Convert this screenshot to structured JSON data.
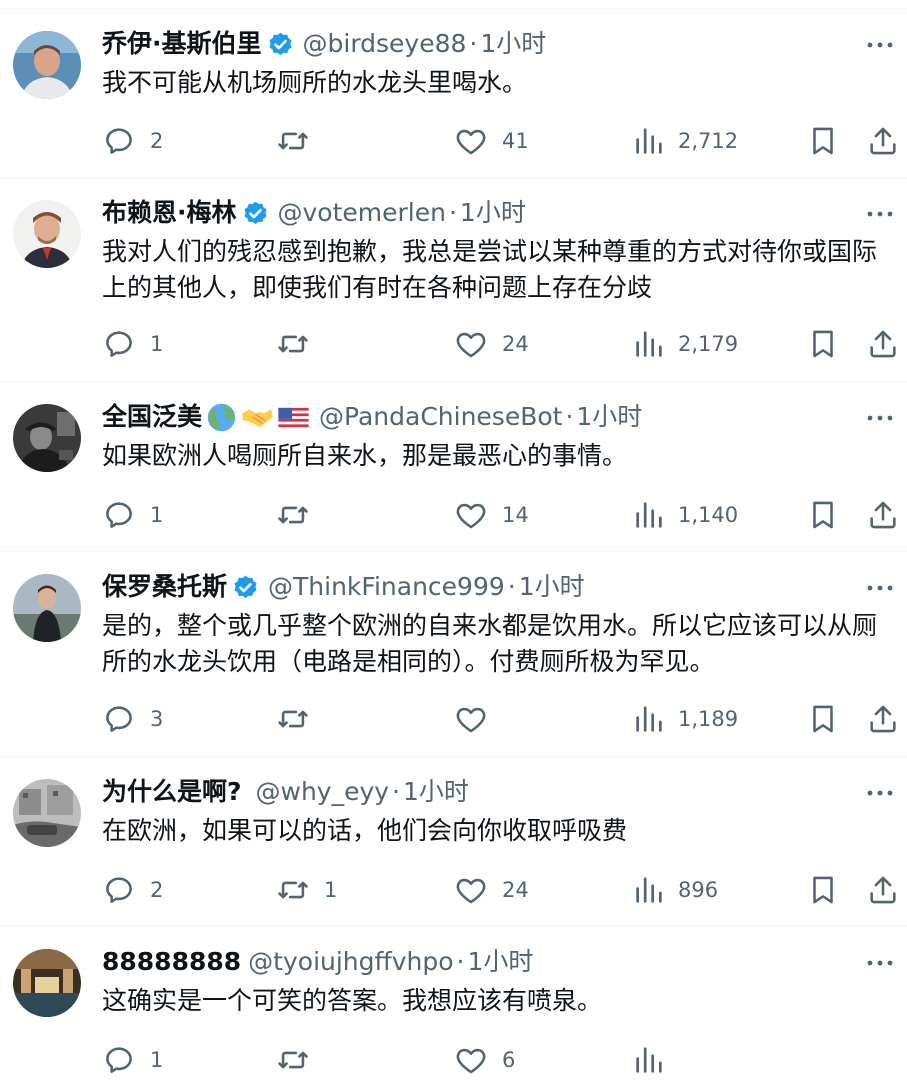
{
  "replies": [
    {
      "name": "乔伊·基斯伯里",
      "verified": true,
      "handle": "@birdseye88",
      "time": "1小时",
      "text": "我不可能从机场厕所的水龙头里喝水。",
      "reply_count": "2",
      "retweet_count": "",
      "like_count": "41",
      "view_count": "2,712"
    },
    {
      "name": "布赖恩·梅林",
      "verified": true,
      "handle": "@votemerlen",
      "time": "1小时",
      "text": "我对人们的残忍感到抱歉，我总是尝试以某种尊重的方式对待你或国际上的其他人，即使我们有时在各种问题上存在分歧",
      "reply_count": "1",
      "retweet_count": "",
      "like_count": "24",
      "view_count": "2,179"
    },
    {
      "name": "全国泛美",
      "verified": false,
      "name_emojis": [
        "globe-emoji",
        "handshake-emoji",
        "us-flag-emoji"
      ],
      "handle": "@PandaChineseBot",
      "time": "1小时",
      "text": "如果欧洲人喝厕所自来水，那是最恶心的事情。",
      "reply_count": "1",
      "retweet_count": "",
      "like_count": "14",
      "view_count": "1,140"
    },
    {
      "name": "保罗桑托斯",
      "verified": true,
      "handle": "@ThinkFinance999",
      "time": "1小时",
      "text": "是的，整个或几乎整个欧洲的自来水都是饮用水。所以它应该可以从厕所的水龙头饮用（电路是相同的）。付费厕所极为罕见。",
      "reply_count": "3",
      "retweet_count": "",
      "like_count": "",
      "view_count": "1,189"
    },
    {
      "name": "为什么是啊?",
      "verified": false,
      "handle": "@why_eyy",
      "time": "1小时",
      "text": "在欧洲，如果可以的话，他们会向你收取呼吸费",
      "reply_count": "2",
      "retweet_count": "1",
      "like_count": "24",
      "view_count": "896"
    },
    {
      "name": "88888888",
      "verified": false,
      "handle": "@tyoiujhgffvhpo",
      "time": "1小时",
      "text": "这确实是一个可笑的答案。我想应该有喷泉。",
      "reply_count": "1",
      "retweet_count": "",
      "like_count": "6",
      "view_count": ""
    }
  ],
  "separator": "·",
  "colors": {
    "text_primary": "#0f1419",
    "text_secondary": "#536471",
    "verified_badge": "#1d9bf0",
    "divider": "#eff3f4"
  }
}
